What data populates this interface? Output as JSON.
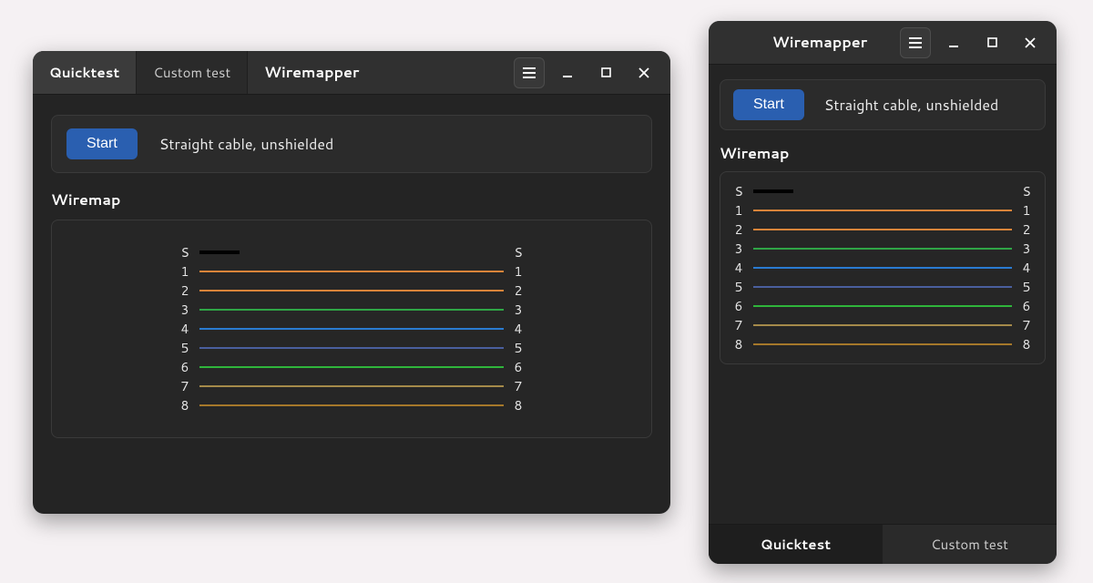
{
  "app": {
    "title": "Wiremapper",
    "tabs": [
      {
        "id": "quicktest",
        "label": "Quicktest",
        "active": true
      },
      {
        "id": "customtest",
        "label": "Custom test",
        "active": false
      }
    ],
    "start_label": "Start",
    "cable_status": "Straight cable, unshielded",
    "section_title": "Wiremap"
  },
  "wiremap": {
    "shield_label": "S",
    "shield_color": "#000000",
    "shield_connected": false,
    "pins": [
      {
        "left": "1",
        "right": "1",
        "color": "#d9843a"
      },
      {
        "left": "2",
        "right": "2",
        "color": "#d9843a"
      },
      {
        "left": "3",
        "right": "3",
        "color": "#2fa546"
      },
      {
        "left": "4",
        "right": "4",
        "color": "#2a7bd1"
      },
      {
        "left": "5",
        "right": "5",
        "color": "#4a5f9e"
      },
      {
        "left": "6",
        "right": "6",
        "color": "#2fb53b"
      },
      {
        "left": "7",
        "right": "7",
        "color": "#a58a4a"
      },
      {
        "left": "8",
        "right": "8",
        "color": "#a5782a"
      }
    ]
  }
}
